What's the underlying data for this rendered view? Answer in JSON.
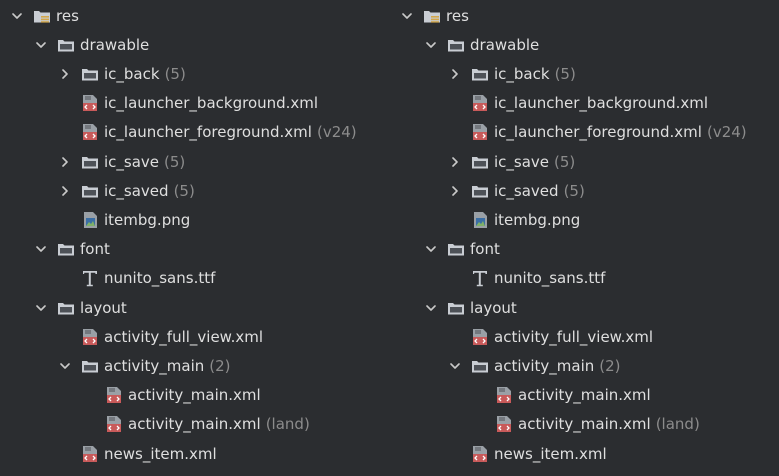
{
  "colors": {
    "background": "#2b2d30",
    "text": "#dfdfdf",
    "hint_text": "#8c8c8c",
    "folder_icon": "#c9cdd3",
    "xml_icon": "#c85a5a",
    "chevron": "#c9c9c9"
  },
  "panels": [
    {
      "tree": [
        {
          "depth": 0,
          "chevron": "expanded",
          "icon": "resource-folder-icon",
          "label": "res",
          "hint": ""
        },
        {
          "depth": 1,
          "chevron": "expanded",
          "icon": "folder-icon",
          "label": "drawable",
          "hint": ""
        },
        {
          "depth": 2,
          "chevron": "collapsed",
          "icon": "folder-icon",
          "label": "ic_back",
          "hint": "(5)"
        },
        {
          "depth": 2,
          "chevron": "none",
          "icon": "xml-file-icon",
          "label": "ic_launcher_background.xml",
          "hint": ""
        },
        {
          "depth": 2,
          "chevron": "none",
          "icon": "xml-file-icon",
          "label": "ic_launcher_foreground.xml",
          "hint": "(v24)"
        },
        {
          "depth": 2,
          "chevron": "collapsed",
          "icon": "folder-icon",
          "label": "ic_save",
          "hint": "(5)"
        },
        {
          "depth": 2,
          "chevron": "collapsed",
          "icon": "folder-icon",
          "label": "ic_saved",
          "hint": "(5)"
        },
        {
          "depth": 2,
          "chevron": "none",
          "icon": "image-file-icon",
          "label": "itembg.png",
          "hint": ""
        },
        {
          "depth": 1,
          "chevron": "expanded",
          "icon": "folder-icon",
          "label": "font",
          "hint": ""
        },
        {
          "depth": 2,
          "chevron": "none",
          "icon": "font-file-icon",
          "label": "nunito_sans.ttf",
          "hint": ""
        },
        {
          "depth": 1,
          "chevron": "expanded",
          "icon": "folder-icon",
          "label": "layout",
          "hint": ""
        },
        {
          "depth": 2,
          "chevron": "none",
          "icon": "xml-file-icon",
          "label": "activity_full_view.xml",
          "hint": ""
        },
        {
          "depth": 2,
          "chevron": "expanded",
          "icon": "folder-icon",
          "label": "activity_main",
          "hint": "(2)"
        },
        {
          "depth": 3,
          "chevron": "none",
          "icon": "xml-file-icon",
          "label": "activity_main.xml",
          "hint": ""
        },
        {
          "depth": 3,
          "chevron": "none",
          "icon": "xml-file-icon",
          "label": "activity_main.xml",
          "hint": "(land)"
        },
        {
          "depth": 2,
          "chevron": "none",
          "icon": "xml-file-icon",
          "label": "news_item.xml",
          "hint": ""
        }
      ]
    },
    {
      "tree": [
        {
          "depth": 0,
          "chevron": "expanded",
          "icon": "resource-folder-icon",
          "label": "res",
          "hint": ""
        },
        {
          "depth": 1,
          "chevron": "expanded",
          "icon": "folder-icon",
          "label": "drawable",
          "hint": ""
        },
        {
          "depth": 2,
          "chevron": "collapsed",
          "icon": "folder-icon",
          "label": "ic_back",
          "hint": "(5)"
        },
        {
          "depth": 2,
          "chevron": "none",
          "icon": "xml-file-icon",
          "label": "ic_launcher_background.xml",
          "hint": ""
        },
        {
          "depth": 2,
          "chevron": "none",
          "icon": "xml-file-icon",
          "label": "ic_launcher_foreground.xml",
          "hint": "(v24)"
        },
        {
          "depth": 2,
          "chevron": "collapsed",
          "icon": "folder-icon",
          "label": "ic_save",
          "hint": "(5)"
        },
        {
          "depth": 2,
          "chevron": "collapsed",
          "icon": "folder-icon",
          "label": "ic_saved",
          "hint": "(5)"
        },
        {
          "depth": 2,
          "chevron": "none",
          "icon": "image-file-icon",
          "label": "itembg.png",
          "hint": ""
        },
        {
          "depth": 1,
          "chevron": "expanded",
          "icon": "folder-icon",
          "label": "font",
          "hint": ""
        },
        {
          "depth": 2,
          "chevron": "none",
          "icon": "font-file-icon",
          "label": "nunito_sans.ttf",
          "hint": ""
        },
        {
          "depth": 1,
          "chevron": "expanded",
          "icon": "folder-icon",
          "label": "layout",
          "hint": ""
        },
        {
          "depth": 2,
          "chevron": "none",
          "icon": "xml-file-icon",
          "label": "activity_full_view.xml",
          "hint": ""
        },
        {
          "depth": 2,
          "chevron": "expanded",
          "icon": "folder-icon",
          "label": "activity_main",
          "hint": "(2)"
        },
        {
          "depth": 3,
          "chevron": "none",
          "icon": "xml-file-icon",
          "label": "activity_main.xml",
          "hint": ""
        },
        {
          "depth": 3,
          "chevron": "none",
          "icon": "xml-file-icon",
          "label": "activity_main.xml",
          "hint": "(land)"
        },
        {
          "depth": 2,
          "chevron": "none",
          "icon": "xml-file-icon",
          "label": "news_item.xml",
          "hint": ""
        }
      ]
    }
  ]
}
